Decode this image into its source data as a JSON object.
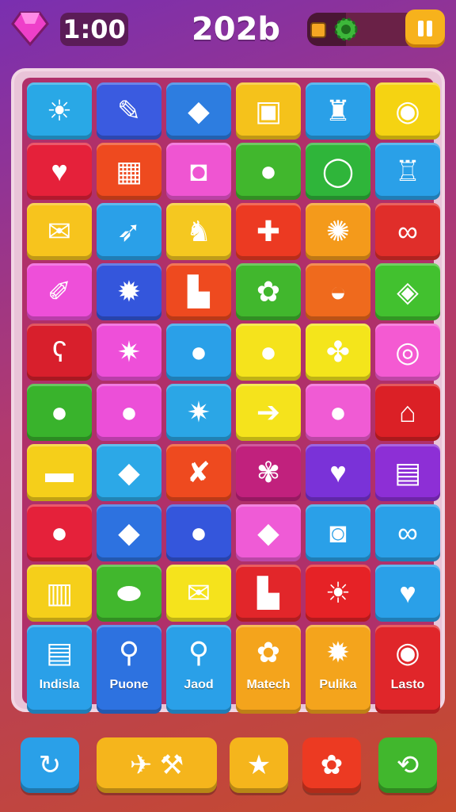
{
  "hud": {
    "timer": "1:00",
    "score": "202b",
    "progress_fraction": 0.35,
    "icons": [
      "gem-icon",
      "coin-icon",
      "gear-icon",
      "pause-icon"
    ]
  },
  "tiles": [
    {
      "color": "#29a8e6",
      "icon": "sun-icon",
      "glyph": "☀"
    },
    {
      "color": "#3a5be0",
      "icon": "pencil-icon",
      "glyph": "✎"
    },
    {
      "color": "#2d7de0",
      "icon": "kite-icon",
      "glyph": "◆"
    },
    {
      "color": "#f5c21b",
      "icon": "window-icon",
      "glyph": "▣"
    },
    {
      "color": "#2aa0e8",
      "icon": "bag-icon",
      "glyph": "♜"
    },
    {
      "color": "#f5d312",
      "icon": "candy-swirl-icon",
      "glyph": "◉"
    },
    {
      "color": "#e5213a",
      "icon": "heart-icon",
      "glyph": "♥"
    },
    {
      "color": "#ee4a1f",
      "icon": "suitcase-icon",
      "glyph": "▦"
    },
    {
      "color": "#ef55d2",
      "icon": "camera-icon",
      "glyph": "◘"
    },
    {
      "color": "#41b72d",
      "icon": "apple-icon",
      "glyph": "●"
    },
    {
      "color": "#2fb53a",
      "icon": "chat-bubble-icon",
      "glyph": "◯"
    },
    {
      "color": "#2aa0e8",
      "icon": "shopping-bag-icon",
      "glyph": "♖"
    },
    {
      "color": "#f7c41d",
      "icon": "envelope-icon",
      "glyph": "✉"
    },
    {
      "color": "#2aa0e8",
      "icon": "leaf-icon",
      "glyph": "➶"
    },
    {
      "color": "#f5c820",
      "icon": "bell-icon",
      "glyph": "♞"
    },
    {
      "color": "#ec3a22",
      "icon": "plus-icon",
      "glyph": "✚"
    },
    {
      "color": "#f49a1b",
      "icon": "gear-flower-icon",
      "glyph": "✺"
    },
    {
      "color": "#e02e2a",
      "icon": "ribbon-icon",
      "glyph": "∞"
    },
    {
      "color": "#ee4fd9",
      "icon": "tag-icon",
      "glyph": "✐"
    },
    {
      "color": "#3456dc",
      "icon": "sun-icon",
      "glyph": "✹"
    },
    {
      "color": "#ee4a1f",
      "icon": "paper-icon",
      "glyph": "▙"
    },
    {
      "color": "#41b72d",
      "icon": "cookie-icon",
      "glyph": "✿"
    },
    {
      "color": "#ef6a1d",
      "icon": "shell-icon",
      "glyph": "◒"
    },
    {
      "color": "#42c12f",
      "icon": "gem-leaf-icon",
      "glyph": "◈"
    },
    {
      "color": "#d81f2c",
      "icon": "hook-icon",
      "glyph": "ʕ"
    },
    {
      "color": "#ee4fd9",
      "icon": "gear-icon",
      "glyph": "✷"
    },
    {
      "color": "#2aa0e8",
      "icon": "orange-icon",
      "glyph": "●"
    },
    {
      "color": "#f5e31c",
      "icon": "cherry-icon",
      "glyph": "●"
    },
    {
      "color": "#f4e51b",
      "icon": "puzzle-icon",
      "glyph": "✤"
    },
    {
      "color": "#f45ad2",
      "icon": "ring-icon",
      "glyph": "◎"
    },
    {
      "color": "#39b32c",
      "icon": "lemon-icon",
      "glyph": "●"
    },
    {
      "color": "#ec4fd8",
      "icon": "berry-icon",
      "glyph": "●"
    },
    {
      "color": "#2ba6e6",
      "icon": "gear-icon",
      "glyph": "✷"
    },
    {
      "color": "#f5e31c",
      "icon": "arrow-right-icon",
      "glyph": "➔"
    },
    {
      "color": "#f05bd4",
      "icon": "blueberry-icon",
      "glyph": "●"
    },
    {
      "color": "#db2026",
      "icon": "house-icon",
      "glyph": "⌂"
    },
    {
      "color": "#f5cf1a",
      "icon": "capsule-icon",
      "glyph": "▬"
    },
    {
      "color": "#2ca8e7",
      "icon": "gem-icon",
      "glyph": "◆"
    },
    {
      "color": "#ee4a1f",
      "icon": "bow-icon",
      "glyph": "✘"
    },
    {
      "color": "#c1217d",
      "icon": "cluster-icon",
      "glyph": "✾"
    },
    {
      "color": "#7a32d8",
      "icon": "heart-icon",
      "glyph": "♥"
    },
    {
      "color": "#8d2fd6",
      "icon": "notebook-icon",
      "glyph": "▤"
    },
    {
      "color": "#e5213a",
      "icon": "fruit-icon",
      "glyph": "●"
    },
    {
      "color": "#2d72e0",
      "icon": "leaf-icon",
      "glyph": "◆"
    },
    {
      "color": "#3456dc",
      "icon": "apple-icon",
      "glyph": "●"
    },
    {
      "color": "#ef5bd6",
      "icon": "lemon-icon",
      "glyph": "◆"
    },
    {
      "color": "#2aa0e8",
      "icon": "toolbox-icon",
      "glyph": "◙"
    },
    {
      "color": "#2aa0e8",
      "icon": "cherries-icon",
      "glyph": "∞"
    },
    {
      "color": "#f5cf1a",
      "icon": "radio-icon",
      "glyph": "▥"
    },
    {
      "color": "#41b72d",
      "icon": "macaron-icon",
      "glyph": "⬬"
    },
    {
      "color": "#f5e31c",
      "icon": "envelope-icon",
      "glyph": "✉"
    },
    {
      "color": "#e2262a",
      "icon": "paper-icon",
      "glyph": "▙"
    },
    {
      "color": "#e62226",
      "icon": "sun-icon",
      "glyph": "☀"
    },
    {
      "color": "#2aa0e8",
      "icon": "heart-icon",
      "glyph": "♥"
    },
    {
      "color": "#2aa0e8",
      "icon": "document-icon",
      "glyph": "▤",
      "label": "Indisla",
      "tall": true
    },
    {
      "color": "#2d72e0",
      "icon": "phone-icon",
      "glyph": "⚲",
      "label": "Puone",
      "tall": true
    },
    {
      "color": "#2aa0e8",
      "icon": "award-icon",
      "glyph": "⚲",
      "label": "Jaod",
      "tall": true
    },
    {
      "color": "#f4a41c",
      "icon": "pig-icon",
      "glyph": "✿",
      "label": "Matech",
      "tall": true
    },
    {
      "color": "#f4a41c",
      "icon": "sun-icon",
      "glyph": "✹",
      "label": "Pulika",
      "tall": true
    },
    {
      "color": "#e0262a",
      "icon": "coin-icon",
      "glyph": "◉",
      "label": "Lasto",
      "tall": true
    }
  ],
  "tile_accents": [
    {
      "color": "#f5e31c",
      "icon": "yellow-tile-icon"
    },
    {
      "color": "#f5e31c",
      "icon": "yellow-tile-icon"
    }
  ],
  "bottom_buttons": [
    {
      "name": "refresh-button",
      "icon": "refresh-icon",
      "glyph": "↻",
      "color": "#2aa0e8"
    },
    {
      "name": "tools-button",
      "icon": "tools-icon",
      "glyph": "✈  ⚒",
      "color": "#f5b51c"
    },
    {
      "name": "star-button",
      "icon": "star-icon",
      "glyph": "★",
      "color": "#f5b51c"
    },
    {
      "name": "hint-button",
      "icon": "hint-icon",
      "glyph": "✿",
      "color": "#ec3a22"
    },
    {
      "name": "shuffle-button",
      "icon": "shuffle-icon",
      "glyph": "⟲",
      "color": "#41b72d"
    }
  ]
}
